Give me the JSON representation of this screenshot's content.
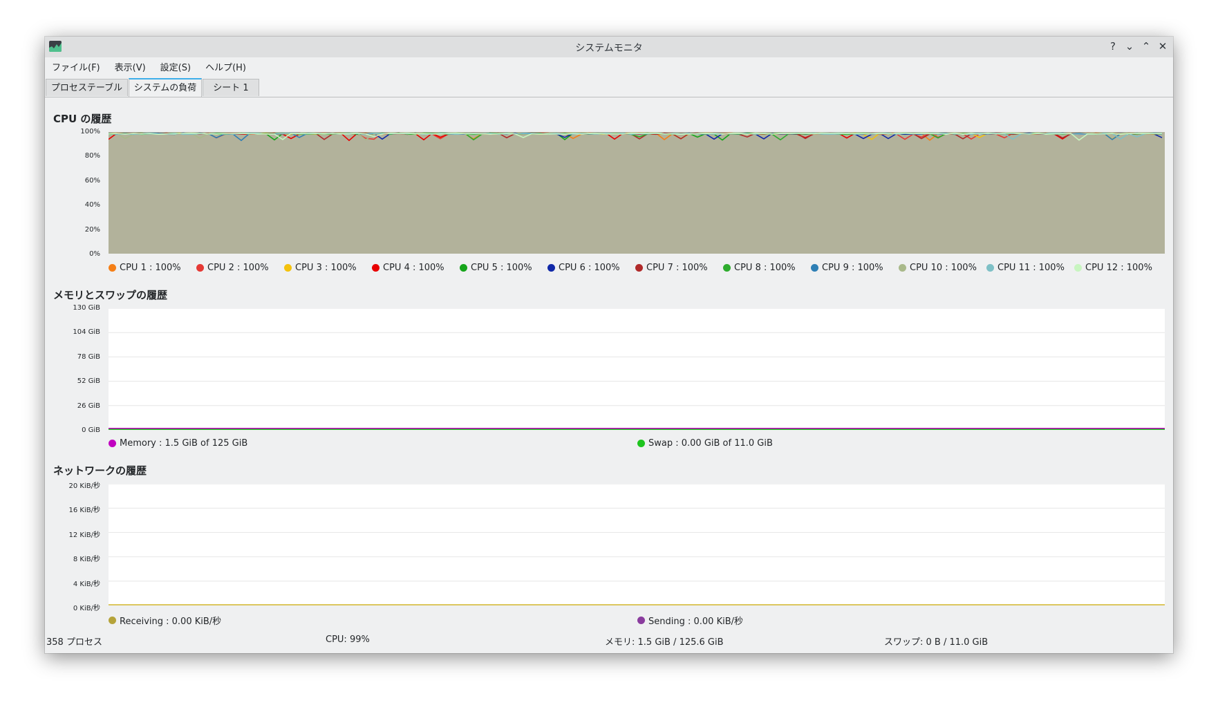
{
  "window": {
    "title": "システムモニタ",
    "app_icon": "system-monitor-icon",
    "controls": [
      {
        "name": "help-button",
        "glyph": "?"
      },
      {
        "name": "minimize-button",
        "glyph": "⌄"
      },
      {
        "name": "maximize-button",
        "glyph": "⌃"
      },
      {
        "name": "close-button",
        "glyph": "✕"
      }
    ]
  },
  "menu": [
    "ファイル(F)",
    "表示(V)",
    "設定(S)",
    "ヘルプ(H)"
  ],
  "tabs": [
    {
      "label": "プロセステーブル",
      "active": false
    },
    {
      "label": "システムの負荷",
      "active": true
    },
    {
      "label": "シート 1",
      "active": false
    }
  ],
  "cpu": {
    "title": "CPU の履歴",
    "ticks": [
      "100%",
      "80%",
      "60%",
      "40%",
      "20%",
      "0%"
    ],
    "fill_color": "#b2b29b",
    "legend": [
      {
        "label": "CPU 1 : 100%",
        "color": "#f57f17"
      },
      {
        "label": "CPU 2 : 100%",
        "color": "#e53935"
      },
      {
        "label": "CPU 3 : 100%",
        "color": "#f4c20d"
      },
      {
        "label": "CPU 4 : 100%",
        "color": "#e80000"
      },
      {
        "label": "CPU 5 : 100%",
        "color": "#16a51b"
      },
      {
        "label": "CPU 6 : 100%",
        "color": "#1028a8"
      },
      {
        "label": "CPU 7 : 100%",
        "color": "#b02a2a"
      },
      {
        "label": "CPU 8 : 100%",
        "color": "#2eac2e"
      },
      {
        "label": "CPU 9 : 100%",
        "color": "#2e7fb5"
      },
      {
        "label": "CPU 10 : 100%",
        "color": "#a9b98a"
      },
      {
        "label": "CPU 11 : 100%",
        "color": "#7ec0c6"
      },
      {
        "label": "CPU 12 : 100%",
        "color": "#c8f5c0"
      }
    ]
  },
  "memory": {
    "title": "メモリとスワップの履歴",
    "ticks": [
      "130 GiB",
      "104 GiB",
      "78 GiB",
      "52 GiB",
      "26 GiB",
      "0 GiB"
    ],
    "legend": [
      {
        "label": "Memory : 1.5 GiB of 125 GiB",
        "color": "#c000c0"
      },
      {
        "label": "Swap : 0.00 GiB of 11.0 GiB",
        "color": "#1ec41e"
      }
    ]
  },
  "network": {
    "title": "ネットワークの履歴",
    "ticks": [
      "20 KiB/秒",
      "16 KiB/秒",
      "12 KiB/秒",
      "8 KiB/秒",
      "4 KiB/秒",
      "0 KiB/秒"
    ],
    "legend": [
      {
        "label": "Receiving : 0.00 KiB/秒",
        "color": "#b5a33a"
      },
      {
        "label": "Sending : 0.00 KiB/秒",
        "color": "#8a3c9e"
      }
    ]
  },
  "status": {
    "processes": "358 プロセス",
    "cpu": "CPU: 99%",
    "memory": "メモリ: 1.5 GiB / 125.6 GiB",
    "swap": "スワップ: 0 B / 11.0 GiB"
  },
  "chart_data": [
    {
      "type": "area",
      "title": "CPU の履歴",
      "ylim": [
        0,
        100
      ],
      "yunit": "%",
      "series": [
        {
          "name": "CPU 1",
          "values": [
            100
          ]
        },
        {
          "name": "CPU 2",
          "values": [
            100
          ]
        },
        {
          "name": "CPU 3",
          "values": [
            100
          ]
        },
        {
          "name": "CPU 4",
          "values": [
            100
          ]
        },
        {
          "name": "CPU 5",
          "values": [
            100
          ]
        },
        {
          "name": "CPU 6",
          "values": [
            100
          ]
        },
        {
          "name": "CPU 7",
          "values": [
            100
          ]
        },
        {
          "name": "CPU 8",
          "values": [
            100
          ]
        },
        {
          "name": "CPU 9",
          "values": [
            100
          ]
        },
        {
          "name": "CPU 10",
          "values": [
            100
          ]
        },
        {
          "name": "CPU 11",
          "values": [
            100
          ]
        },
        {
          "name": "CPU 12",
          "values": [
            100
          ]
        }
      ],
      "grid": true
    },
    {
      "type": "line",
      "title": "メモリとスワップの履歴",
      "ylim": [
        0,
        130
      ],
      "yunit": "GiB",
      "series": [
        {
          "name": "Memory",
          "values": [
            1.5
          ]
        },
        {
          "name": "Swap",
          "values": [
            0.0
          ]
        }
      ],
      "grid": true
    },
    {
      "type": "line",
      "title": "ネットワークの履歴",
      "ylim": [
        0,
        20
      ],
      "yunit": "KiB/秒",
      "series": [
        {
          "name": "Receiving",
          "values": [
            0.0
          ]
        },
        {
          "name": "Sending",
          "values": [
            0.0
          ]
        }
      ],
      "grid": true
    }
  ]
}
